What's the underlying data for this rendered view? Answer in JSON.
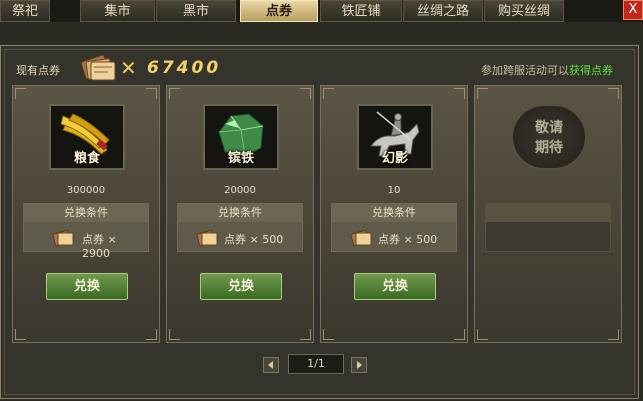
{
  "tabs": [
    {
      "label": "祭祀"
    },
    {
      "label": "集市"
    },
    {
      "label": "黑市"
    },
    {
      "label": "点券"
    },
    {
      "label": "铁匠铺"
    },
    {
      "label": "丝绸之路"
    },
    {
      "label": "购买丝绸"
    }
  ],
  "close_label": "X",
  "balance": {
    "label": "现有点券",
    "multiplier": "✕",
    "value": "67400"
  },
  "hint": {
    "text": "参加跨服活动可以",
    "link": "获得点券"
  },
  "items": [
    {
      "name": "粮食",
      "qty": "300000",
      "condition_title": "兑换条件",
      "cost": "点券 × 2900",
      "button": "兑换"
    },
    {
      "name": "镔铁",
      "qty": "20000",
      "condition_title": "兑换条件",
      "cost": "点券 × 500",
      "button": "兑换"
    },
    {
      "name": "幻影",
      "qty": "10",
      "condition_title": "兑换条件",
      "cost": "点券 × 500",
      "button": "兑换"
    }
  ],
  "coming_soon": {
    "line1": "敬请",
    "line2": "期待"
  },
  "pagination": {
    "text": "1/1"
  },
  "colors": {
    "accent_gold": "#f4d36a",
    "link_green": "#5fe03a",
    "button_green": "#3b6a22"
  }
}
